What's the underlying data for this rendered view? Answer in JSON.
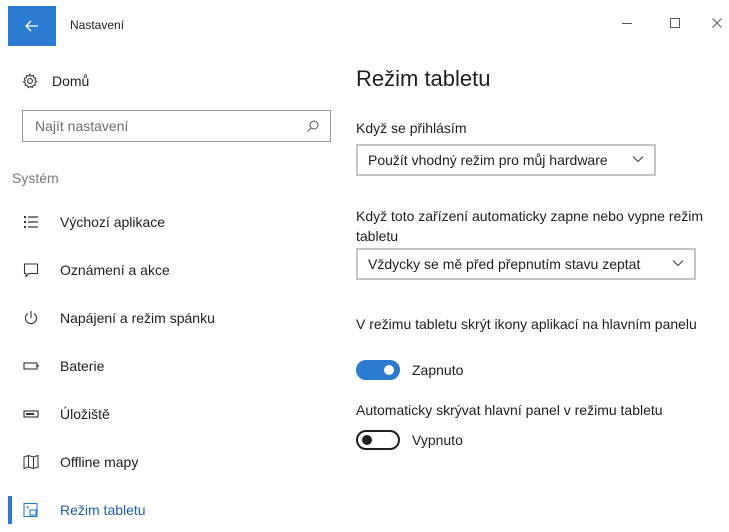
{
  "window": {
    "title": "Nastavení",
    "accent_color": "#2b7bd3",
    "controls": {
      "minimize_icon": "minimize-icon",
      "maximize_icon": "maximize-icon",
      "close_icon": "close-icon"
    }
  },
  "sidebar": {
    "home": {
      "label": "Domů",
      "icon": "gear-icon"
    },
    "search": {
      "placeholder": "Najít nastavení",
      "value": "",
      "icon": "search-icon"
    },
    "section_header": "Systém",
    "items": [
      {
        "label": "Výchozí aplikace",
        "icon": "default-apps-icon",
        "active": false
      },
      {
        "label": "Oznámení a akce",
        "icon": "notification-icon",
        "active": false
      },
      {
        "label": "Napájení a režim spánku",
        "icon": "power-icon",
        "active": false
      },
      {
        "label": "Baterie",
        "icon": "battery-icon",
        "active": false
      },
      {
        "label": "Úložiště",
        "icon": "storage-icon",
        "active": false
      },
      {
        "label": "Offline mapy",
        "icon": "map-icon",
        "active": false
      },
      {
        "label": "Režim tabletu",
        "icon": "tablet-mode-icon",
        "active": true
      }
    ]
  },
  "main": {
    "title": "Režim tabletu",
    "signin": {
      "label": "Když se přihlásím",
      "value": "Použít vhodný režim pro můj hardware"
    },
    "auto_switch": {
      "label": "Když toto zařízení automaticky zapne nebo vypne režim tabletu",
      "value": "Vždycky se mě před přepnutím stavu zeptat"
    },
    "hide_icons": {
      "label": "V režimu tabletu skrýt ikony aplikací na hlavním panelu",
      "state_label": "Zapnuto",
      "on": true
    },
    "autohide_taskbar": {
      "label": "Automaticky skrývat hlavní panel v režimu tabletu",
      "state_label": "Vypnuto",
      "on": false
    }
  }
}
